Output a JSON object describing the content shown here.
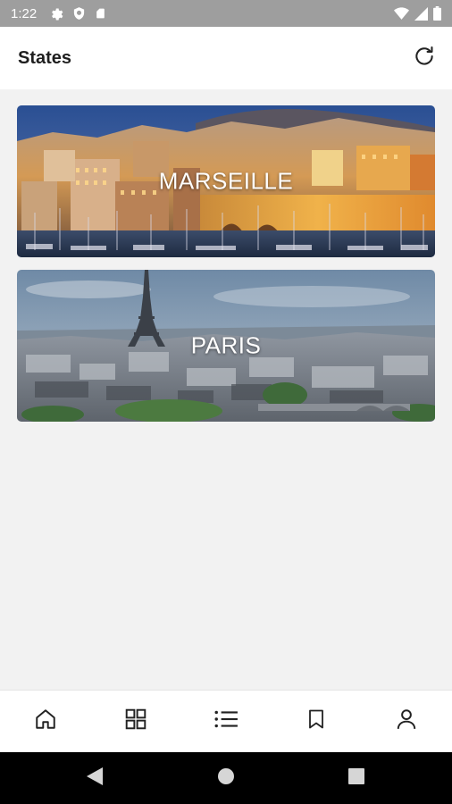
{
  "status_bar": {
    "time": "1:22",
    "icons": [
      "gear-icon",
      "shield-icon",
      "sd-card-icon",
      "wifi-icon",
      "signal-icon",
      "battery-icon"
    ]
  },
  "header": {
    "title": "States",
    "refresh_icon": "refresh-icon"
  },
  "cities": [
    {
      "name": "MARSEILLE",
      "theme": "harbor-night"
    },
    {
      "name": "PARIS",
      "theme": "eiffel-skyline"
    }
  ],
  "bottom_nav": {
    "items": [
      "home-icon",
      "grid-icon",
      "list-icon",
      "bookmark-icon",
      "profile-icon"
    ]
  },
  "system_nav": {
    "items": [
      "back-icon",
      "home-circle-icon",
      "recents-icon"
    ]
  },
  "colors": {
    "status_bar": "#9e9e9e",
    "app_background": "#f2f2f2",
    "surface": "#ffffff",
    "icon": "#222222"
  }
}
